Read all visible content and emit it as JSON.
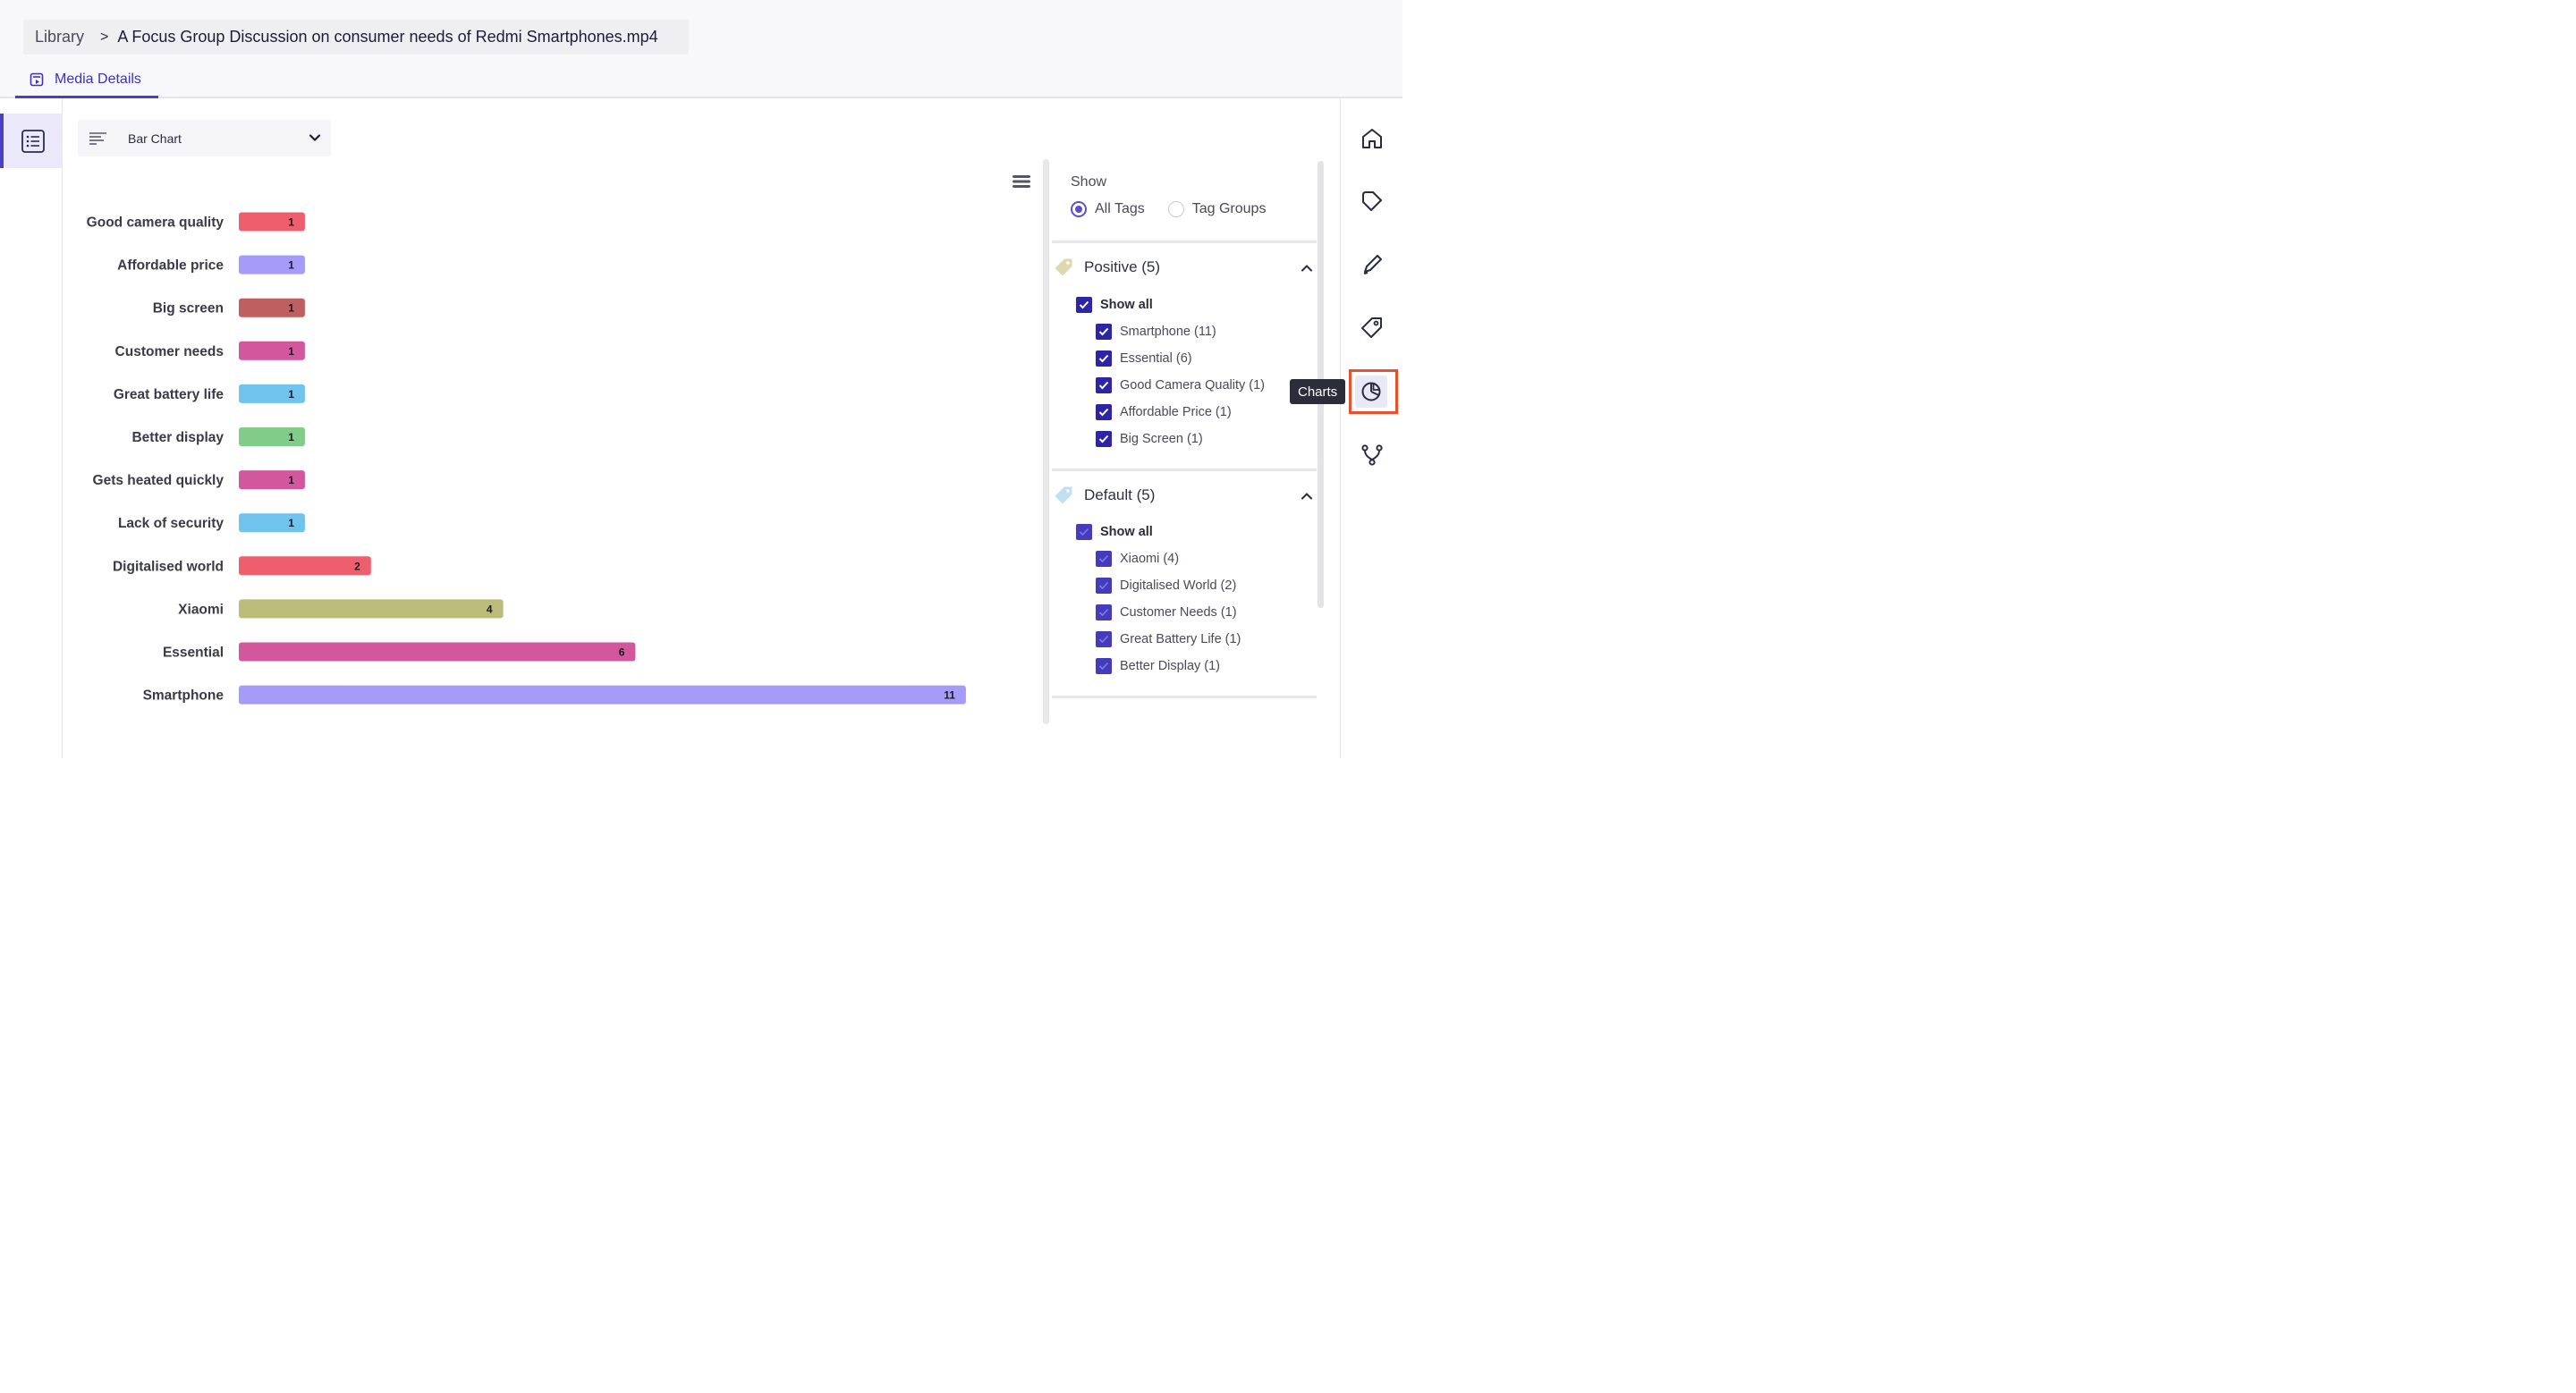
{
  "breadcrumb": {
    "root": "Library",
    "separator": ">",
    "title": "A Focus Group Discussion on consumer needs of Redmi Smartphones.mp4"
  },
  "tabs": [
    {
      "label": "Media Details",
      "icon": "media-details-icon",
      "active": true
    }
  ],
  "chart_selector": {
    "value": "Bar Chart",
    "icon": "bar-chart-icon"
  },
  "chart_data": {
    "type": "bar",
    "orientation": "horizontal",
    "categories": [
      "Good camera quality",
      "Affordable price",
      "Big screen",
      "Customer needs",
      "Great battery life",
      "Better display",
      "Gets heated quickly",
      "Lack of security",
      "Digitalised world",
      "Xiaomi",
      "Essential",
      "Smartphone"
    ],
    "values": [
      1,
      1,
      1,
      1,
      1,
      1,
      1,
      1,
      2,
      4,
      6,
      11
    ],
    "colors": [
      "#ee5f6e",
      "#a49cf8",
      "#c05f5f",
      "#d2579c",
      "#70c3ec",
      "#82cc8a",
      "#d2579c",
      "#70c3ec",
      "#ee5f6e",
      "#bcbc7a",
      "#d2579c",
      "#a49cf8"
    ],
    "xlim": [
      0,
      11
    ],
    "grid": false,
    "data_labels": true
  },
  "filter_panel": {
    "show_label": "Show",
    "radio_options": [
      {
        "label": "All Tags",
        "selected": true
      },
      {
        "label": "Tag Groups",
        "selected": false
      }
    ],
    "groups": [
      {
        "title": "Positive (5)",
        "tag_color": "#d9d4a6",
        "show_all": "Show all",
        "items": [
          "Smartphone (11)",
          "Essential (6)",
          "Good Camera Quality (1)",
          "Affordable Price (1)",
          "Big Screen (1)"
        ]
      },
      {
        "title": "Default (5)",
        "tag_color": "#b5dcf0",
        "show_all": "Show all",
        "items": [
          "Xiaomi (4)",
          "Digitalised World (2)",
          "Customer Needs (1)",
          "Great Battery Life (1)",
          "Better Display (1)"
        ]
      }
    ]
  },
  "right_rail": {
    "items": [
      "home-icon",
      "tag-icon",
      "pen-icon",
      "tags-icon",
      "pie-chart-icon",
      "branch-icon"
    ],
    "active": "pie-chart-icon",
    "tooltip": "Charts"
  },
  "colors": {
    "accent": "#4b3fc4",
    "highlight": "#e8512e",
    "checkbox": "#2d25a8"
  }
}
